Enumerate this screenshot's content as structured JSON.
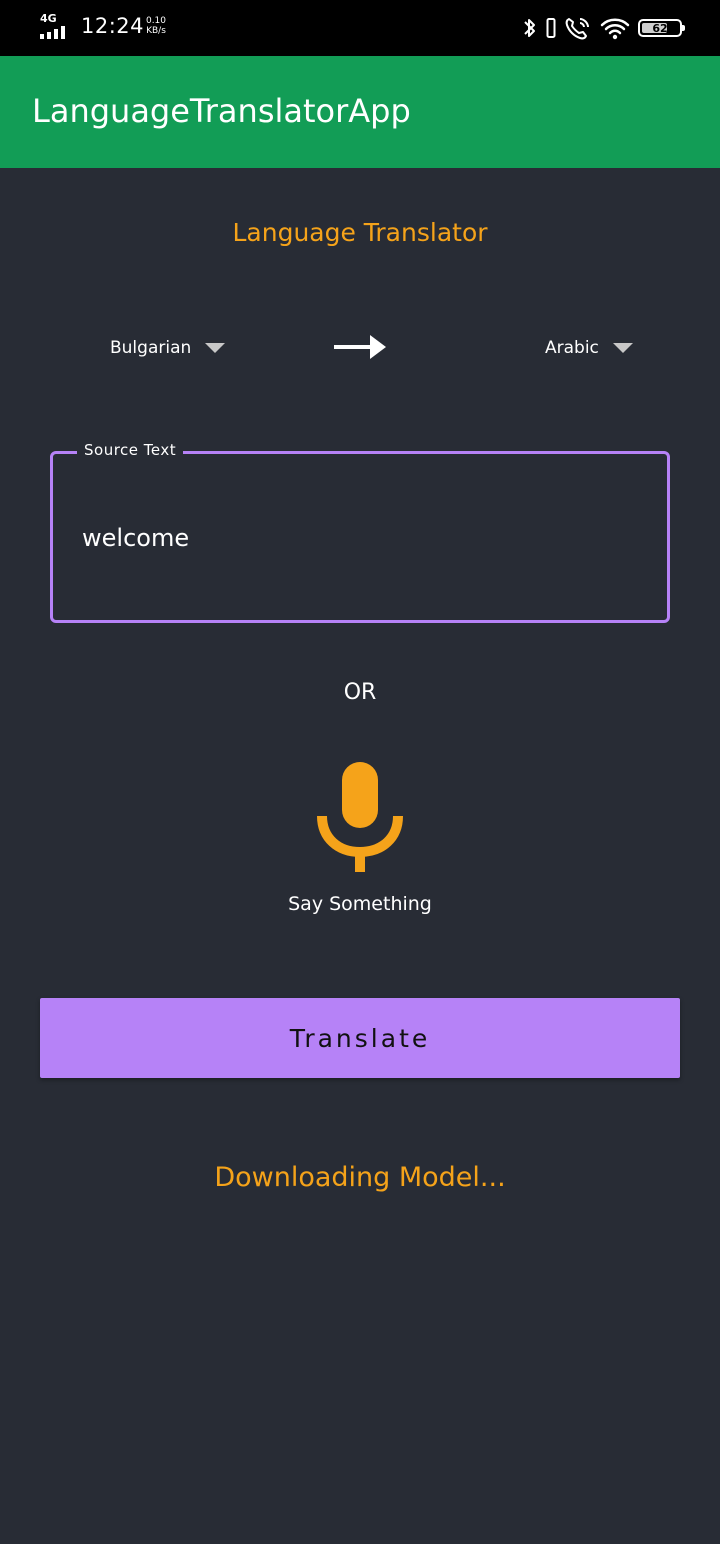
{
  "status_bar": {
    "network": "4G",
    "time": "12:24",
    "speed_value": "0.10",
    "speed_unit": "KB/s",
    "battery_level": "62",
    "icons": [
      "signal-icon",
      "bluetooth-icon",
      "vibrate-icon",
      "wifi-calling-icon",
      "wifi-icon",
      "battery-icon"
    ]
  },
  "app_bar": {
    "title": "LanguageTranslatorApp"
  },
  "main": {
    "heading": "Language Translator",
    "source_language": "Bulgarian",
    "target_language": "Arabic",
    "arrow_icon": "arrow-right-icon",
    "source_field": {
      "label": "Source Text",
      "value": "welcome"
    },
    "or_label": "OR",
    "mic_icon": "microphone-icon",
    "say_label": "Say Something",
    "translate_label": "Translate",
    "status": "Downloading Model..."
  },
  "colors": {
    "background": "#282c35",
    "app_bar": "#129d56",
    "accent_orange": "#f5a31a",
    "accent_purple": "#b682f7",
    "status_bar": "#000000"
  }
}
